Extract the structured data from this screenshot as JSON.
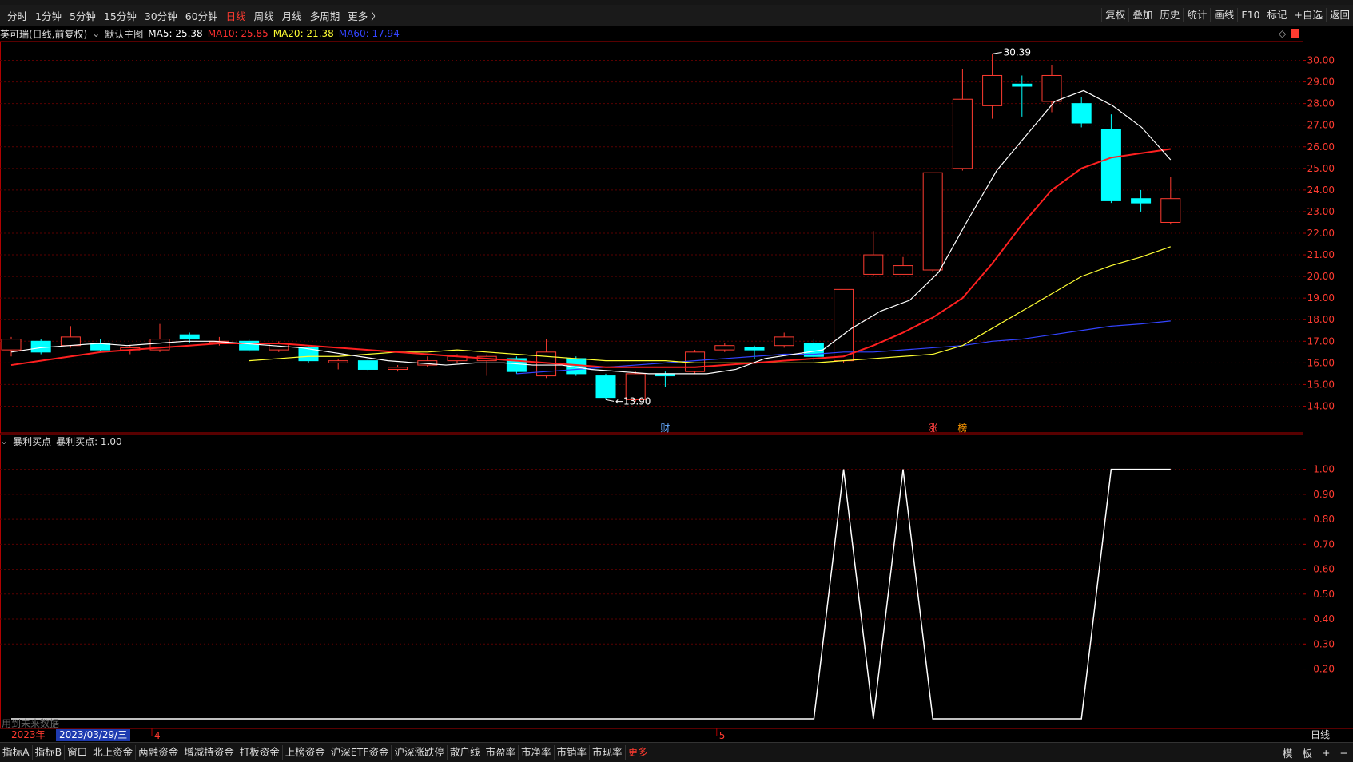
{
  "toolbar": {
    "periods": [
      {
        "label": "分时",
        "active": false
      },
      {
        "label": "1分钟",
        "active": false
      },
      {
        "label": "5分钟",
        "active": false
      },
      {
        "label": "15分钟",
        "active": false
      },
      {
        "label": "30分钟",
        "active": false
      },
      {
        "label": "60分钟",
        "active": false
      },
      {
        "label": "日线",
        "active": true
      },
      {
        "label": "周线",
        "active": false
      },
      {
        "label": "月线",
        "active": false
      },
      {
        "label": "多周期",
        "active": false
      },
      {
        "label": "更多 〉",
        "active": false
      }
    ],
    "right_buttons": [
      "复权",
      "叠加",
      "历史",
      "统计",
      "画线",
      "F10",
      "标记",
      "+自选",
      "返回"
    ]
  },
  "main_header": {
    "stock": "英可瑞(日线,前复权)",
    "template": "默认主图",
    "ma5": "MA5: 25.38",
    "ma10": "MA10: 25.85",
    "ma20": "MA20: 21.38",
    "ma60": "MA60: 17.94"
  },
  "sub_header": {
    "name": "暴利买点",
    "value": "暴利买点: 1.00"
  },
  "colors": {
    "up": "#ff3b30",
    "down": "#00ffff",
    "ma5": "#ffffff",
    "ma10": "#ff2020",
    "ma20": "#ffff33",
    "ma60": "#3344ff",
    "grid": "#5a0000",
    "axis": "#b00000"
  },
  "chart_data": [
    {
      "type": "candlestick",
      "ylim": [
        13.5,
        30.5
      ],
      "yticks": [
        "30.00",
        "29.00",
        "28.00",
        "27.00",
        "26.00",
        "25.00",
        "24.00",
        "23.00",
        "22.00",
        "21.00",
        "20.00",
        "19.00",
        "18.00",
        "17.00",
        "16.00",
        "15.00",
        "14.00"
      ],
      "candles": [
        [
          16.6,
          17.1,
          17.2,
          16.3
        ],
        [
          17.0,
          16.5,
          17.1,
          16.4
        ],
        [
          16.8,
          17.2,
          17.7,
          16.7
        ],
        [
          16.9,
          16.6,
          17.1,
          16.5
        ],
        [
          16.6,
          16.7,
          16.8,
          16.4
        ],
        [
          16.6,
          17.1,
          17.8,
          16.5
        ],
        [
          17.3,
          17.1,
          17.4,
          16.9
        ],
        [
          17.0,
          17.0,
          17.2,
          16.8
        ],
        [
          17.0,
          16.6,
          17.1,
          16.5
        ],
        [
          16.6,
          16.9,
          17.0,
          16.5
        ],
        [
          16.7,
          16.1,
          16.8,
          16.0
        ],
        [
          16.0,
          16.1,
          16.2,
          15.7
        ],
        [
          16.1,
          15.7,
          16.2,
          15.6
        ],
        [
          15.7,
          15.8,
          15.9,
          15.6
        ],
        [
          15.9,
          16.1,
          16.3,
          15.8
        ],
        [
          16.1,
          16.3,
          16.4,
          16.0
        ],
        [
          16.1,
          16.3,
          16.4,
          15.4
        ],
        [
          16.2,
          15.6,
          16.3,
          15.5
        ],
        [
          15.4,
          16.5,
          17.1,
          15.3
        ],
        [
          16.2,
          15.5,
          16.3,
          15.4
        ],
        [
          15.4,
          14.4,
          15.5,
          14.3
        ],
        [
          14.3,
          15.5,
          15.6,
          14.2
        ],
        [
          15.5,
          15.4,
          15.6,
          14.9
        ],
        [
          15.6,
          16.5,
          16.6,
          15.5
        ],
        [
          16.6,
          16.8,
          16.9,
          16.5
        ],
        [
          16.7,
          16.6,
          16.8,
          16.2
        ],
        [
          16.8,
          17.2,
          17.4,
          16.7
        ],
        [
          16.9,
          16.3,
          17.1,
          16.1
        ],
        [
          16.1,
          19.4,
          19.4,
          16.0
        ],
        [
          20.1,
          21.0,
          22.1,
          20.0
        ],
        [
          20.1,
          20.5,
          20.9,
          20.1
        ],
        [
          20.3,
          24.8,
          24.8,
          20.2
        ],
        [
          25.0,
          28.2,
          29.6,
          24.9
        ],
        [
          27.9,
          29.3,
          30.3,
          27.3
        ],
        [
          28.9,
          28.8,
          29.3,
          27.4
        ],
        [
          28.1,
          29.3,
          29.8,
          27.6
        ],
        [
          28.0,
          27.1,
          28.3,
          26.9
        ],
        [
          26.8,
          23.5,
          27.5,
          23.4
        ],
        [
          23.6,
          23.4,
          24.0,
          23.0
        ],
        [
          22.5,
          23.6,
          24.6,
          22.4
        ]
      ],
      "ma5": [
        16.5,
        16.7,
        16.8,
        16.9,
        16.8,
        16.9,
        17.0,
        17.0,
        16.9,
        16.8,
        16.7,
        16.5,
        16.3,
        16.1,
        16.0,
        15.9,
        16.0,
        16.0,
        15.9,
        15.9,
        15.7,
        15.6,
        15.5,
        15.5,
        15.5,
        15.7,
        16.2,
        16.4,
        16.6,
        17.6,
        18.4,
        18.9,
        20.2,
        22.6,
        24.9,
        26.5,
        28.1,
        28.6,
        27.9,
        26.9,
        25.4
      ],
      "ma10": [
        15.9,
        16.1,
        16.3,
        16.5,
        16.6,
        16.7,
        16.8,
        16.9,
        16.9,
        16.9,
        16.8,
        16.7,
        16.6,
        16.5,
        16.4,
        16.3,
        16.2,
        16.1,
        16.0,
        15.9,
        15.8,
        15.8,
        15.8,
        15.8,
        15.9,
        16.0,
        16.1,
        16.2,
        16.3,
        16.8,
        17.4,
        18.1,
        19.0,
        20.6,
        22.4,
        24.0,
        25.0,
        25.5,
        25.7,
        25.9
      ],
      "ma20": [
        16.1,
        16.2,
        16.3,
        16.3,
        16.4,
        16.5,
        16.5,
        16.6,
        16.5,
        16.4,
        16.3,
        16.2,
        16.1,
        16.1,
        16.1,
        16.0,
        16.0,
        16.0,
        16.0,
        16.0,
        16.1,
        16.2,
        16.3,
        16.4,
        16.8,
        17.6,
        18.4,
        19.2,
        20.0,
        20.5,
        20.9,
        21.38
      ],
      "ma60": [
        15.5,
        15.6,
        15.7,
        15.8,
        15.9,
        16.0,
        16.1,
        16.2,
        16.3,
        16.4,
        16.4,
        16.5,
        16.5,
        16.6,
        16.7,
        16.8,
        17.0,
        17.1,
        17.3,
        17.5,
        17.7,
        17.8,
        17.94
      ],
      "annotations": [
        {
          "text": "30.39",
          "kind": "high",
          "candle": 33
        },
        {
          "text": "13.90",
          "kind": "low",
          "candle": 20
        },
        {
          "text": "财",
          "kind": "marker",
          "candle": 22,
          "color": "#66aaff"
        },
        {
          "text": "涨",
          "kind": "marker",
          "candle": 31,
          "color": "#ff4040"
        },
        {
          "text": "榜",
          "kind": "marker",
          "candle": 32,
          "color": "#ff9900"
        }
      ]
    },
    {
      "type": "line",
      "series_name": "暴利买点",
      "ylim": [
        0,
        1.05
      ],
      "yticks": [
        "1.00",
        "0.90",
        "0.80",
        "0.70",
        "0.60",
        "0.50",
        "0.40",
        "0.30",
        "0.20"
      ],
      "x": [
        0,
        27,
        28,
        29,
        30,
        31,
        32,
        36,
        37,
        39
      ],
      "values": [
        0,
        0,
        1,
        0,
        1,
        0,
        0,
        0,
        1,
        1
      ]
    }
  ],
  "time_axis": {
    "year": "2023年",
    "cursor_date": "2023/03/29/三",
    "month_labels": [
      {
        "text": "4",
        "candle": 5
      },
      {
        "text": "5",
        "candle": 24
      }
    ],
    "right_label": "日线"
  },
  "future_note": "用到未来数据",
  "bottom_tabs": [
    "指标A",
    "指标B",
    "窗口",
    "北上资金",
    "两融资金",
    "增减持资金",
    "打板资金",
    "上榜资金",
    "沪深ETF资金",
    "沪深涨跌停",
    "散户线",
    "市盈率",
    "市净率",
    "市销率",
    "市现率",
    "更多"
  ],
  "bottom_right": [
    "模",
    "板",
    "+",
    "−"
  ]
}
